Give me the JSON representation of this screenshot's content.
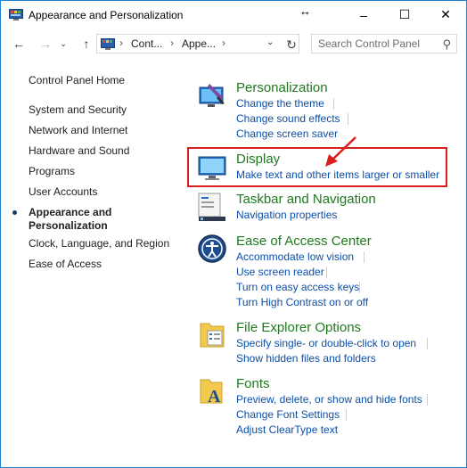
{
  "window": {
    "title": "Appearance and Personalization",
    "minimize": "–",
    "maximize": "☐",
    "close": "✕",
    "cursor": "↔"
  },
  "navbar": {
    "back": "←",
    "forward": "→",
    "history": "⌄",
    "up": "↑",
    "breadcrumbs": [
      "Cont...",
      "Appe..."
    ],
    "separator": "›",
    "dropdown": "⌄",
    "refresh": "↻",
    "search_placeholder": "Search Control Panel",
    "search_value": "",
    "search_icon": "⚲"
  },
  "sidebar": {
    "items": [
      {
        "label": "Control Panel Home"
      },
      {
        "label": "System and Security"
      },
      {
        "label": "Network and Internet"
      },
      {
        "label": "Hardware and Sound"
      },
      {
        "label": "Programs"
      },
      {
        "label": "User Accounts"
      },
      {
        "label": "Appearance and"
      },
      {
        "label": "Personalization"
      },
      {
        "label": "Clock, Language, and Region"
      },
      {
        "label": "Ease of Access"
      }
    ],
    "active_item": "Appearance and Personalization"
  },
  "categories": [
    {
      "title": "Personalization",
      "icon": "personalization-icon",
      "tasks": [
        "Change the theme",
        "Change sound effects",
        "Change screen saver"
      ]
    },
    {
      "title": "Display",
      "icon": "display-icon",
      "tasks": [
        "Make text and other items larger or smaller"
      ]
    },
    {
      "title": "Taskbar and Navigation",
      "icon": "taskbar-icon",
      "tasks": [
        "Navigation properties"
      ]
    },
    {
      "title": "Ease of Access Center",
      "icon": "ease-of-access-icon",
      "tasks": [
        "Accommodate low vision",
        "Use screen reader",
        "Turn on easy access keys",
        "Turn High Contrast on or off"
      ]
    },
    {
      "title": "File Explorer Options",
      "icon": "folder-options-icon",
      "tasks": [
        "Specify single- or double-click to open",
        "Show hidden files and folders"
      ]
    },
    {
      "title": "Fonts",
      "icon": "fonts-icon",
      "tasks": [
        "Preview, delete, or show and hide fonts",
        "Change Font Settings",
        "Adjust ClearType text"
      ]
    }
  ],
  "colors": {
    "category_title": "#1e7a1e",
    "task_link": "#0b4fa8",
    "highlight_border": "#d9201c",
    "window_border": "#1883d7"
  }
}
